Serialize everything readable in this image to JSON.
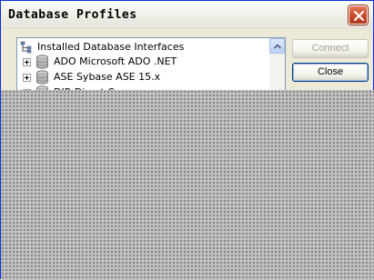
{
  "window": {
    "title": "Database Profiles",
    "close_icon": "close-icon"
  },
  "tree": {
    "root_label": "Installed Database Interfaces",
    "items": [
      {
        "label": "ADO Microsoft ADO .NET",
        "icon": "database-icon"
      },
      {
        "label": "ASE Sybase ASE 15.x",
        "icon": "database-icon"
      },
      {
        "label": "DIR Direct Cor",
        "icon": "database-icon"
      }
    ]
  },
  "buttons": {
    "connect": "Connect",
    "close": "Close"
  },
  "colors": {
    "title_close_red": "#cc4b2a",
    "disabled_text": "#a5a294",
    "border_blue": "#003c74"
  }
}
